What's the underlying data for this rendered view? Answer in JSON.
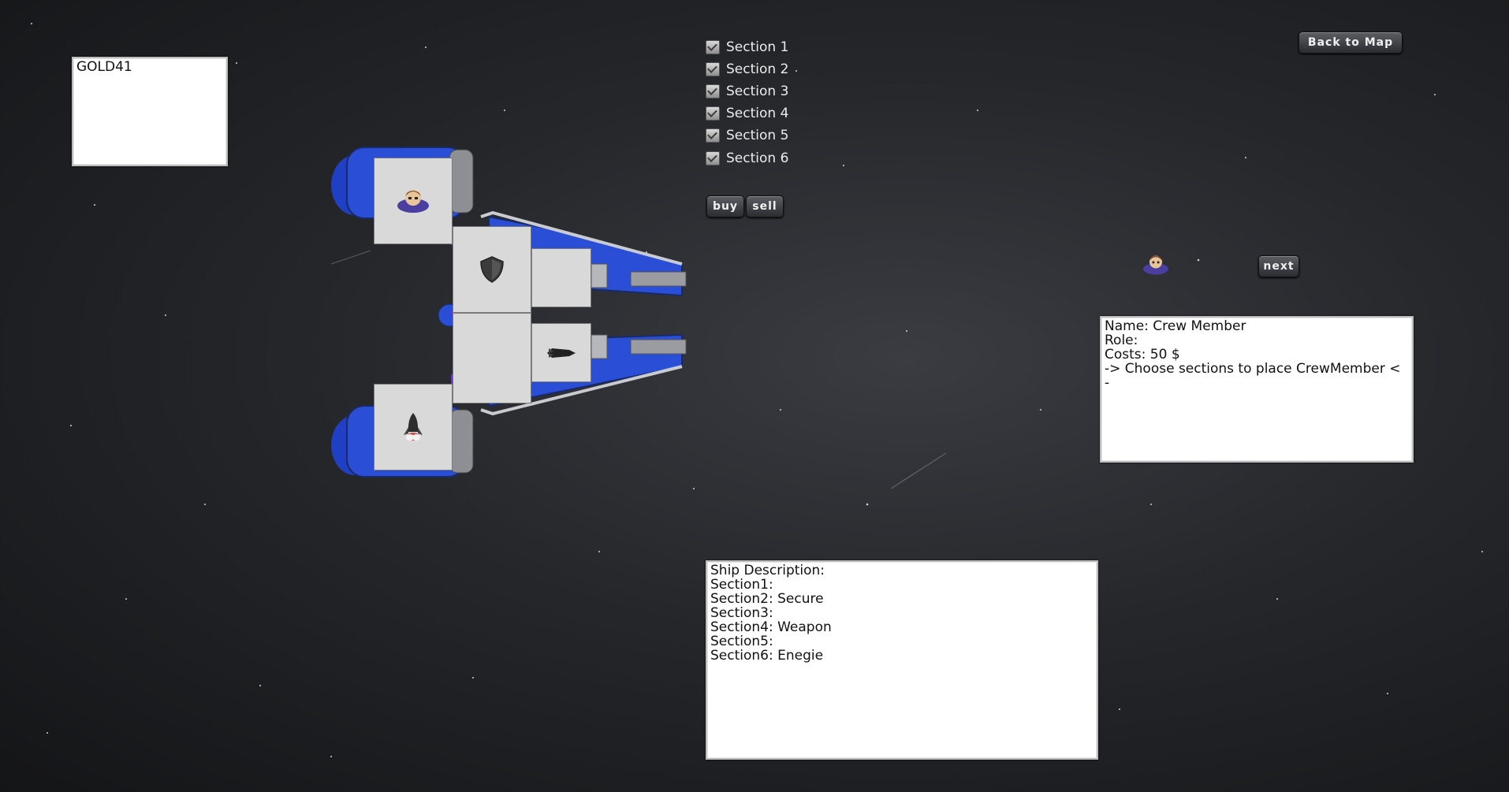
{
  "gold_panel": {
    "text": "GOLD41"
  },
  "sections": [
    {
      "label": "Section 1",
      "checked": true
    },
    {
      "label": "Section 2",
      "checked": true
    },
    {
      "label": "Section 3",
      "checked": true
    },
    {
      "label": "Section 4",
      "checked": true
    },
    {
      "label": "Section 5",
      "checked": true
    },
    {
      "label": "Section 6",
      "checked": true
    }
  ],
  "buttons": {
    "buy": "buy",
    "sell": "sell",
    "back_to_map": "Back to Map",
    "next": "next"
  },
  "crew_info": {
    "lines": [
      "Name: Crew Member",
      "Role:",
      "Costs: 50 $",
      "-> Choose sections to place CrewMember <",
      "-"
    ]
  },
  "ship_description": {
    "lines": [
      "Ship Description:",
      "Section1:",
      "Section2: Secure",
      "Section3:",
      "Section4: Weapon",
      "Section5:",
      "Section6: Enegie"
    ]
  },
  "ship_sections": [
    {
      "id": 1,
      "icon": "crew-member-icon"
    },
    {
      "id": 2,
      "icon": "shield-icon"
    },
    {
      "id": 3,
      "icon": ""
    },
    {
      "id": 4,
      "icon": ""
    },
    {
      "id": 5,
      "icon": "missile-icon"
    },
    {
      "id": 6,
      "icon": "rocket-icon"
    }
  ],
  "colors": {
    "ship_blue": "#2a4fd6",
    "panel_bg": "#ffffff",
    "button_dark": "#2b2c30"
  }
}
